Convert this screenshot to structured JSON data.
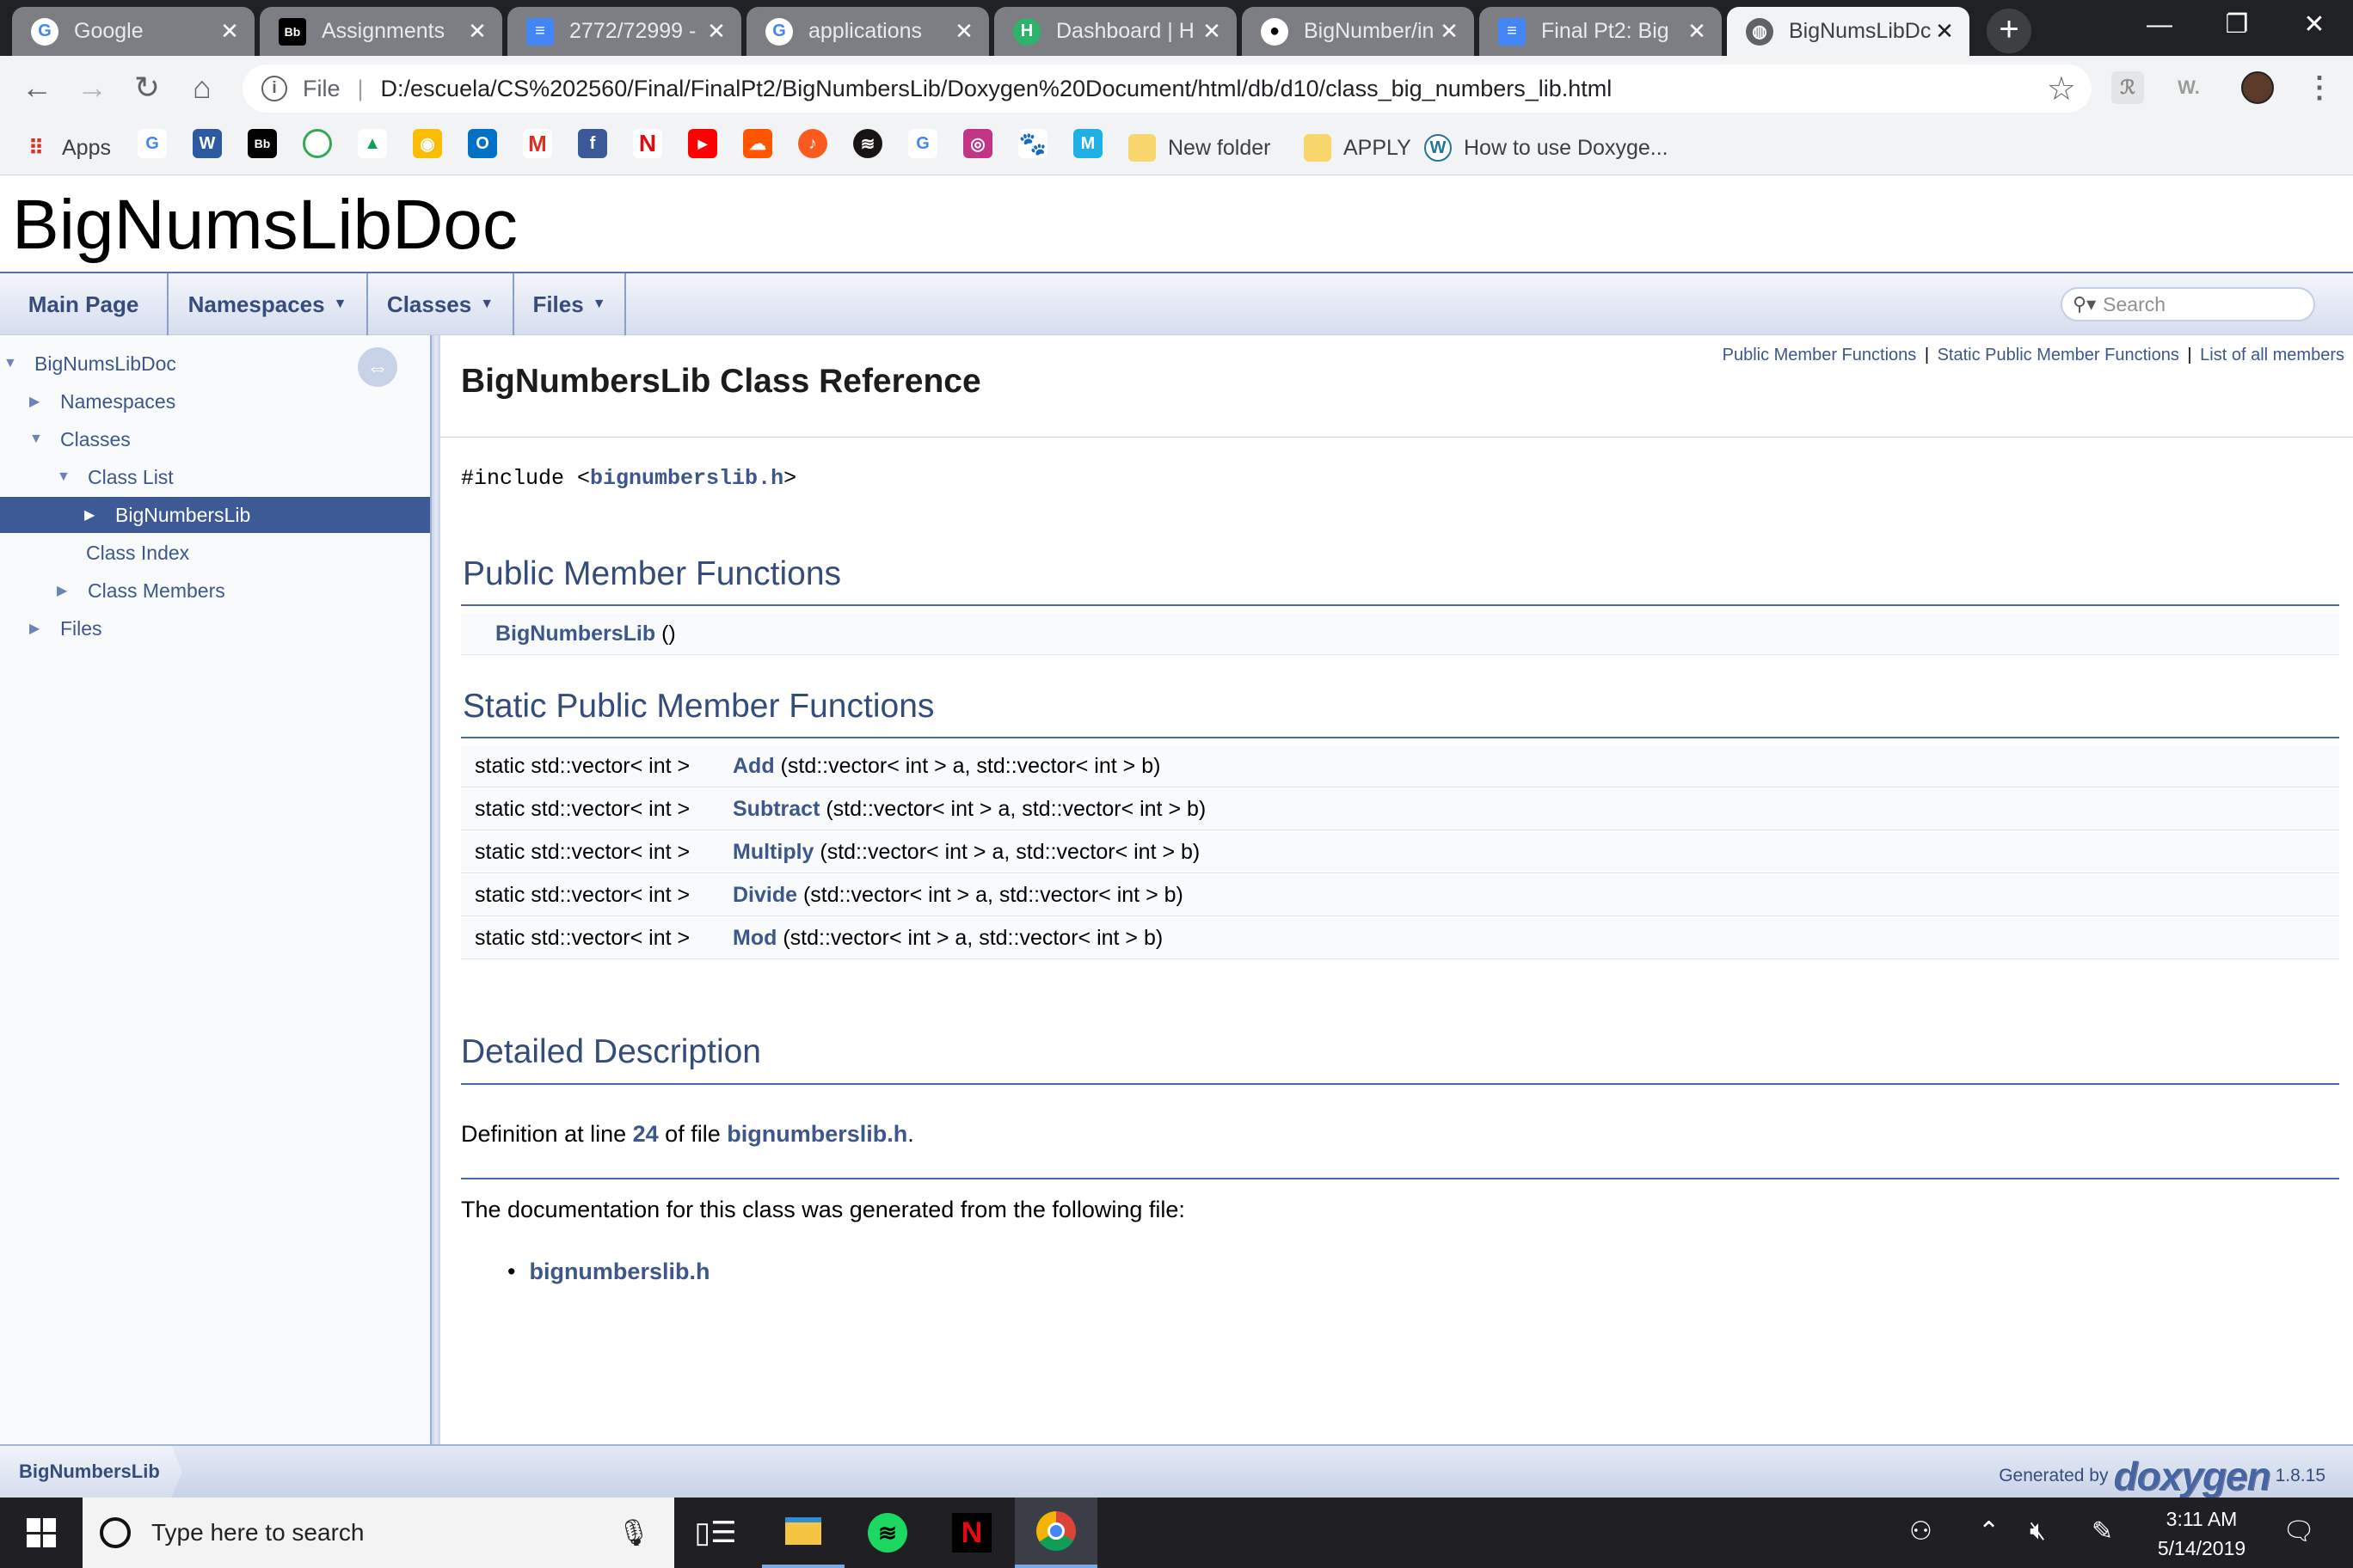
{
  "browser": {
    "tabs": [
      {
        "title": "Google",
        "icon": "google-icon"
      },
      {
        "title": "Assignments",
        "icon": "blackboard-icon"
      },
      {
        "title": "2772/72999 -",
        "icon": "docs-icon"
      },
      {
        "title": "applications",
        "icon": "google-icon"
      },
      {
        "title": "Dashboard | H",
        "icon": "handshake-icon"
      },
      {
        "title": "BigNumber/in",
        "icon": "github-icon"
      },
      {
        "title": "Final Pt2: Big",
        "icon": "docs-icon"
      },
      {
        "title": "BigNumsLibDc",
        "icon": "globe-icon"
      }
    ],
    "new_tab": "+",
    "window": {
      "minimize": "—",
      "restore": "❐",
      "close": "✕"
    },
    "address": {
      "info": "i",
      "scheme": "File",
      "separator": "|",
      "url": "D:/escuela/CS%202560/Final/FinalPt2/BigNumbersLib/Doxygen%20Document/html/db/d10/class_big_numbers_lib.html"
    },
    "extensions": [
      "ℛ",
      "W."
    ],
    "bookmarks": {
      "apps": "Apps",
      "new_folder": "New folder",
      "apply": "APPLY",
      "doxygen": "How to use Doxyge..."
    }
  },
  "doc": {
    "project_name": "BigNumsLibDoc",
    "nav": {
      "main_page": "Main Page",
      "namespaces": "Namespaces",
      "classes": "Classes",
      "files": "Files",
      "search_placeholder": "Search"
    },
    "tree": {
      "root": "BigNumsLibDoc",
      "namespaces": "Namespaces",
      "classes": "Classes",
      "class_list": "Class List",
      "selected": "BigNumbersLib",
      "class_index": "Class Index",
      "class_members": "Class Members",
      "files": "Files"
    },
    "summary_links": {
      "public": "Public Member Functions",
      "static": "Static Public Member Functions",
      "all": "List of all members",
      "bar": "|"
    },
    "class_title": "BigNumbersLib Class Reference",
    "include": {
      "prefix": "#include <",
      "file": "bignumberslib.h",
      "suffix": ">"
    },
    "public_heading": "Public Member Functions",
    "constructor": {
      "name": "BigNumbersLib",
      "args": " ()"
    },
    "static_heading": "Static Public Member Functions",
    "static_functions": [
      {
        "ret": "static std::vector< int > ",
        "name": "Add",
        "args": " (std::vector< int > a, std::vector< int > b)"
      },
      {
        "ret": "static std::vector< int > ",
        "name": "Subtract",
        "args": " (std::vector< int > a, std::vector< int > b)"
      },
      {
        "ret": "static std::vector< int > ",
        "name": "Multiply",
        "args": " (std::vector< int > a, std::vector< int > b)"
      },
      {
        "ret": "static std::vector< int > ",
        "name": "Divide",
        "args": " (std::vector< int > a, std::vector< int > b)"
      },
      {
        "ret": "static std::vector< int > ",
        "name": "Mod",
        "args": " (std::vector< int > a, std::vector< int > b)"
      }
    ],
    "detail_heading": "Detailed Description",
    "definition": {
      "pre": "Definition at line ",
      "line": "24",
      "mid": " of file ",
      "file": "bignumberslib.h",
      "post": "."
    },
    "generated_from": "The documentation for this class was generated from the following file:",
    "source_file": "bignumberslib.h",
    "footer": {
      "breadcrumb": "BigNumbersLib",
      "generated_by": "Generated by",
      "logo": "doxygen",
      "version": "1.8.15"
    }
  },
  "taskbar": {
    "search_placeholder": "Type here to search",
    "time": "3:11 AM",
    "date": "5/14/2019"
  },
  "colors": {
    "doxygen_link": "#3d578c",
    "doxygen_heading": "#354c7b",
    "tab_strip": "#202124",
    "selected_tree_item": "#3e5a96"
  }
}
